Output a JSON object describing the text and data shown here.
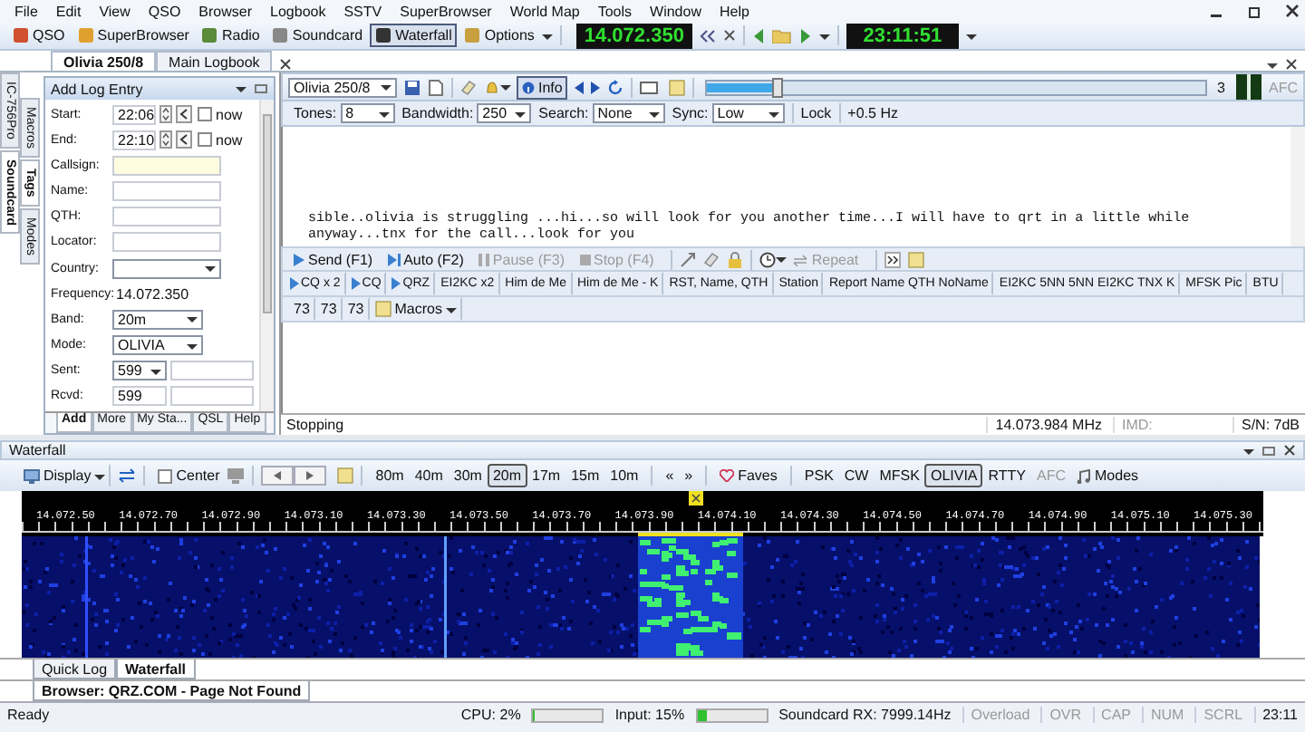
{
  "menu": [
    "File",
    "Edit",
    "View",
    "QSO",
    "Browser",
    "Logbook",
    "SSTV",
    "SuperBrowser",
    "World Map",
    "Tools",
    "Window",
    "Help"
  ],
  "toolbar": {
    "buttons": [
      {
        "label": "QSO",
        "selected": false
      },
      {
        "label": "SuperBrowser",
        "selected": false
      },
      {
        "label": "Radio",
        "selected": false
      },
      {
        "label": "Soundcard",
        "selected": false
      },
      {
        "label": "Waterfall",
        "selected": true
      },
      {
        "label": "Options",
        "selected": false
      }
    ],
    "frequency": "14.072.350",
    "time": "23:11:51"
  },
  "doc_tabs": [
    {
      "label": "Olivia 250/8",
      "selected": true
    },
    {
      "label": "Main Logbook",
      "selected": false
    }
  ],
  "side_tabs_outer": [
    {
      "label": "IC-756Pro",
      "selected": false
    },
    {
      "label": "Soundcard",
      "selected": true
    }
  ],
  "side_tabs_inner": [
    {
      "label": "Macros",
      "selected": false
    },
    {
      "label": "Tags",
      "selected": true
    },
    {
      "label": "Modes",
      "selected": false
    }
  ],
  "log_entry": {
    "title": "Add Log Entry",
    "fields": [
      {
        "kind": "time",
        "label": "Start:",
        "value": "22:06",
        "now_label": "now",
        "now_checked": false
      },
      {
        "kind": "time",
        "label": "End:",
        "value": "22:10",
        "now_label": "now",
        "now_checked": false
      },
      {
        "kind": "text",
        "label": "Callsign:",
        "highlighted": true
      },
      {
        "kind": "text",
        "label": "Name:",
        "highlighted": false
      },
      {
        "kind": "text",
        "label": "QTH:",
        "highlighted": false
      },
      {
        "kind": "text",
        "label": "Locator:",
        "highlighted": false
      },
      {
        "kind": "dropdown",
        "label": "Country:"
      },
      {
        "kind": "readout",
        "label": "Frequency:",
        "value": "14.072.350"
      },
      {
        "kind": "dropdown",
        "label": "Band:",
        "value": "20m"
      },
      {
        "kind": "dropdown",
        "label": "Mode:",
        "value": "OLIVIA"
      },
      {
        "kind": "combo",
        "label": "Sent:",
        "value": "599"
      },
      {
        "kind": "pair",
        "label": "Rcvd:",
        "value": "599"
      }
    ],
    "tabs": [
      {
        "label": "Add",
        "selected": true
      },
      {
        "label": "More",
        "selected": false
      },
      {
        "label": "My Sta...",
        "selected": false
      },
      {
        "label": "QSL",
        "selected": false
      },
      {
        "label": "Help",
        "selected": false
      }
    ]
  },
  "decoder": {
    "mode": "Olivia 250/8",
    "info": {
      "label": "Info",
      "selected": true
    },
    "squelch": {
      "level": 0.14,
      "reading": "3"
    },
    "afc": {
      "label": "AFC",
      "disabled": true
    },
    "settings": [
      {
        "label": "Tones:",
        "value": "8"
      },
      {
        "label": "Bandwidth:",
        "value": "250"
      },
      {
        "label": "Search:",
        "value": "None"
      },
      {
        "label": "Sync:",
        "value": "Low"
      }
    ],
    "lock": "Lock",
    "offset": "+0.5 Hz",
    "received_text": [
      "sible..olivia is struggling ...hi...so will look for you another time...I will have to qrt in a little while",
      "anyway...tnx for the call...look for you"
    ],
    "send_buttons": [
      {
        "kind": "send",
        "label": "Send (F1)",
        "disabled": false
      },
      {
        "kind": "auto",
        "label": "Auto (F2)",
        "disabled": false
      },
      {
        "kind": "pause",
        "label": "Pause (F3)",
        "disabled": true
      },
      {
        "kind": "stop",
        "label": "Stop (F4)",
        "disabled": true
      }
    ],
    "repeat": {
      "label": "Repeat",
      "disabled": true
    },
    "macros": [
      {
        "kind": "send",
        "label": "CQ x 2"
      },
      {
        "kind": "send",
        "label": "CQ"
      },
      {
        "kind": "send",
        "label": "QRZ"
      },
      {
        "kind": "text",
        "label": "EI2KC x2"
      },
      {
        "kind": "text",
        "label": "Him de Me"
      },
      {
        "kind": "text",
        "label": "Him de Me - K"
      },
      {
        "kind": "text",
        "label": "RST, Name, QTH"
      },
      {
        "kind": "text",
        "label": "Station"
      },
      {
        "kind": "text",
        "label": "Report Name QTH NoName"
      },
      {
        "kind": "text",
        "label": "EI2KC 5NN 5NN EI2KC TNX K"
      },
      {
        "kind": "text",
        "label": "MFSK Pic"
      },
      {
        "kind": "text",
        "label": "BTU"
      }
    ],
    "macros_row2": [
      "73",
      "73",
      "73"
    ],
    "macros_menu": "Macros",
    "status": {
      "text": "Stopping",
      "frequency": "14.073.984 MHz",
      "imd": "IMD:",
      "snr": "S/N: 7dB"
    }
  },
  "waterfall": {
    "title": "Waterfall",
    "display": "Display",
    "center": {
      "label": "Center",
      "checked": false
    },
    "bands": [
      {
        "label": "80m",
        "selected": false
      },
      {
        "label": "40m",
        "selected": false
      },
      {
        "label": "30m",
        "selected": false
      },
      {
        "label": "20m",
        "selected": true
      },
      {
        "label": "17m",
        "selected": false
      },
      {
        "label": "15m",
        "selected": false
      },
      {
        "label": "10m",
        "selected": false
      }
    ],
    "band_prev": "«",
    "band_next": "»",
    "faves": "Faves",
    "modes": [
      {
        "label": "PSK",
        "selected": false,
        "disabled": false
      },
      {
        "label": "CW",
        "selected": false,
        "disabled": false
      },
      {
        "label": "MFSK",
        "selected": false,
        "disabled": false
      },
      {
        "label": "OLIVIA",
        "selected": true,
        "disabled": false
      },
      {
        "label": "RTTY",
        "selected": false,
        "disabled": false
      },
      {
        "label": "AFC",
        "selected": false,
        "disabled": true
      }
    ],
    "modes_menu": "Modes",
    "scale": [
      "14.072.50",
      "14.072.70",
      "14.072.90",
      "14.073.10",
      "14.073.30",
      "14.073.50",
      "14.073.70",
      "14.073.90",
      "14.074.10",
      "14.074.30",
      "14.074.50",
      "14.074.70",
      "14.074.90",
      "14.075.10",
      "14.075.30"
    ],
    "tabs": [
      {
        "label": "Quick Log",
        "selected": false
      },
      {
        "label": "Waterfall",
        "selected": true
      }
    ]
  },
  "browser_tab": "Browser: QRZ.COM - Page Not Found",
  "status_bar": {
    "text": "Ready",
    "cpu": {
      "label": "CPU: 2%",
      "level": 0.02
    },
    "input": {
      "label": "Input: 15%",
      "level": 0.15
    },
    "soundcard": "Soundcard RX: 7999.14Hz",
    "indicators": [
      {
        "label": "Overload",
        "on": false
      },
      {
        "label": "OVR",
        "on": false
      },
      {
        "label": "CAP",
        "on": false
      },
      {
        "label": "NUM",
        "on": false
      },
      {
        "label": "SCRL",
        "on": false
      }
    ],
    "time": "23:11"
  }
}
